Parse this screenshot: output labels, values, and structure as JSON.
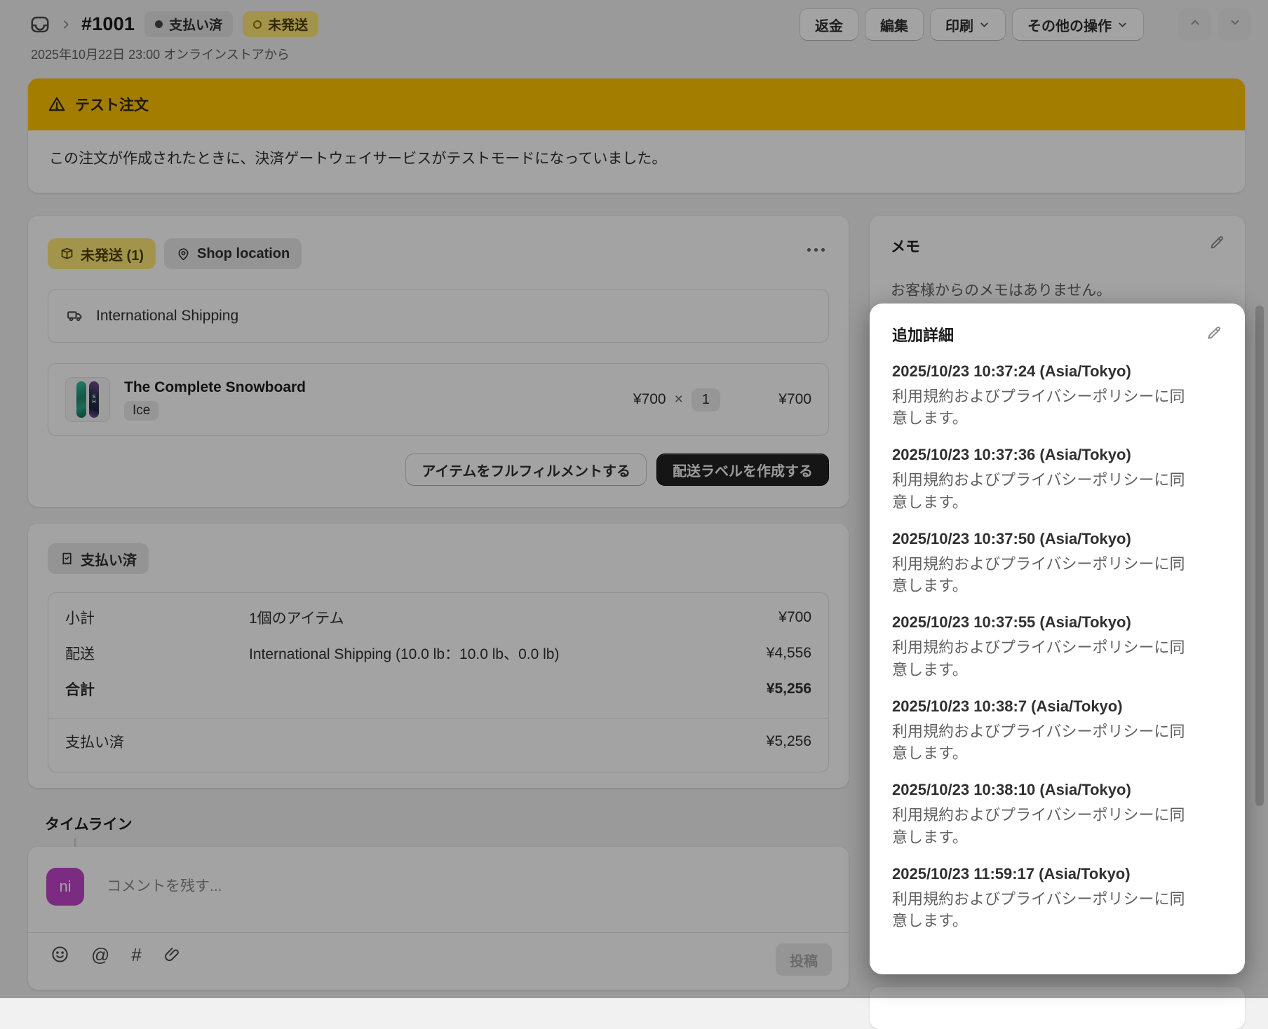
{
  "header": {
    "order_number": "#1001",
    "payment_status_badge": "支払い済",
    "fulfillment_status_badge": "未発送",
    "date_line": "2025年10月22日 23:00 オンラインストアから",
    "actions": {
      "refund": "返金",
      "edit": "編集",
      "print": "印刷",
      "more": "その他の操作"
    }
  },
  "test_banner": {
    "title": "テスト注文",
    "body": "この注文が作成されたときに、決済ゲートウェイサービスがテストモードになっていました。"
  },
  "fulfillment_card": {
    "status_badge": "未発送 (1)",
    "location_badge": "Shop location",
    "shipping_method": "International Shipping",
    "line_item": {
      "title": "The Complete Snowboard",
      "variant": "Ice",
      "unit_price": "¥700",
      "multiply_sign": "×",
      "quantity": "1",
      "line_total": "¥700"
    },
    "buttons": {
      "fulfill_items": "アイテムをフルフィルメントする",
      "create_shipping_label": "配送ラベルを作成する"
    }
  },
  "payment_card": {
    "status_badge": "支払い済",
    "rows": [
      {
        "label": "小計",
        "detail": "1個のアイテム",
        "amount": "¥700"
      },
      {
        "label": "配送",
        "detail": "International Shipping (10.0 lb：10.0 lb、0.0 lb)",
        "amount": "¥4,556"
      },
      {
        "label": "合計",
        "detail": "",
        "amount": "¥5,256"
      }
    ],
    "paid_row": {
      "label": "支払い済",
      "amount": "¥5,256"
    }
  },
  "timeline": {
    "heading": "タイムライン",
    "avatar_initials": "ni",
    "comment_placeholder": "コメントを残す...",
    "post_button": "投稿"
  },
  "notes_card": {
    "heading": "メモ",
    "empty_text": "お客様からのメモはありません。"
  },
  "additional_details_card": {
    "heading": "追加詳細",
    "entries": [
      {
        "timestamp": "2025/10/23 10:37:24 (Asia/Tokyo)",
        "text": "利用規約およびプライバシーポリシーに同意します。"
      },
      {
        "timestamp": "2025/10/23 10:37:36 (Asia/Tokyo)",
        "text": "利用規約およびプライバシーポリシーに同意します。"
      },
      {
        "timestamp": "2025/10/23 10:37:50 (Asia/Tokyo)",
        "text": "利用規約およびプライバシーポリシーに同意します。"
      },
      {
        "timestamp": "2025/10/23 10:37:55 (Asia/Tokyo)",
        "text": "利用規約およびプライバシーポリシーに同意します。"
      },
      {
        "timestamp": "2025/10/23 10:38:7 (Asia/Tokyo)",
        "text": "利用規約およびプライバシーポリシーに同意します。"
      },
      {
        "timestamp": "2025/10/23 10:38:10 (Asia/Tokyo)",
        "text": "利用規約およびプライバシーポリシーに同意します。"
      },
      {
        "timestamp": "2025/10/23 11:59:17 (Asia/Tokyo)",
        "text": "利用規約およびプライバシーポリシーに同意します。"
      }
    ]
  },
  "icons": {
    "header": [
      "orders-icon",
      "chevron-right-icon",
      "paid-dot-icon",
      "unfulfilled-circle-icon"
    ],
    "actions": [
      "chevron-down-icon",
      "chevron-up-icon"
    ],
    "fulfillment": [
      "package-icon",
      "location-pin-icon",
      "ellipsis-icon",
      "truck-icon"
    ],
    "banner": [
      "warning-triangle-icon"
    ],
    "payment": [
      "receipt-check-icon"
    ],
    "composer": [
      "smiley-icon",
      "mention-icon",
      "hashtag-icon",
      "paperclip-icon"
    ],
    "sidebar": [
      "pencil-icon"
    ]
  },
  "colors": {
    "page_background": "#f1f1f1",
    "banner_header": "#ffc400",
    "attention_badge": "#ffe878",
    "primary_button": "#212121",
    "avatar": "#c044c8",
    "overlay": "rgba(0,0,0,0.36)",
    "spotlight_background": "#ffffff"
  }
}
